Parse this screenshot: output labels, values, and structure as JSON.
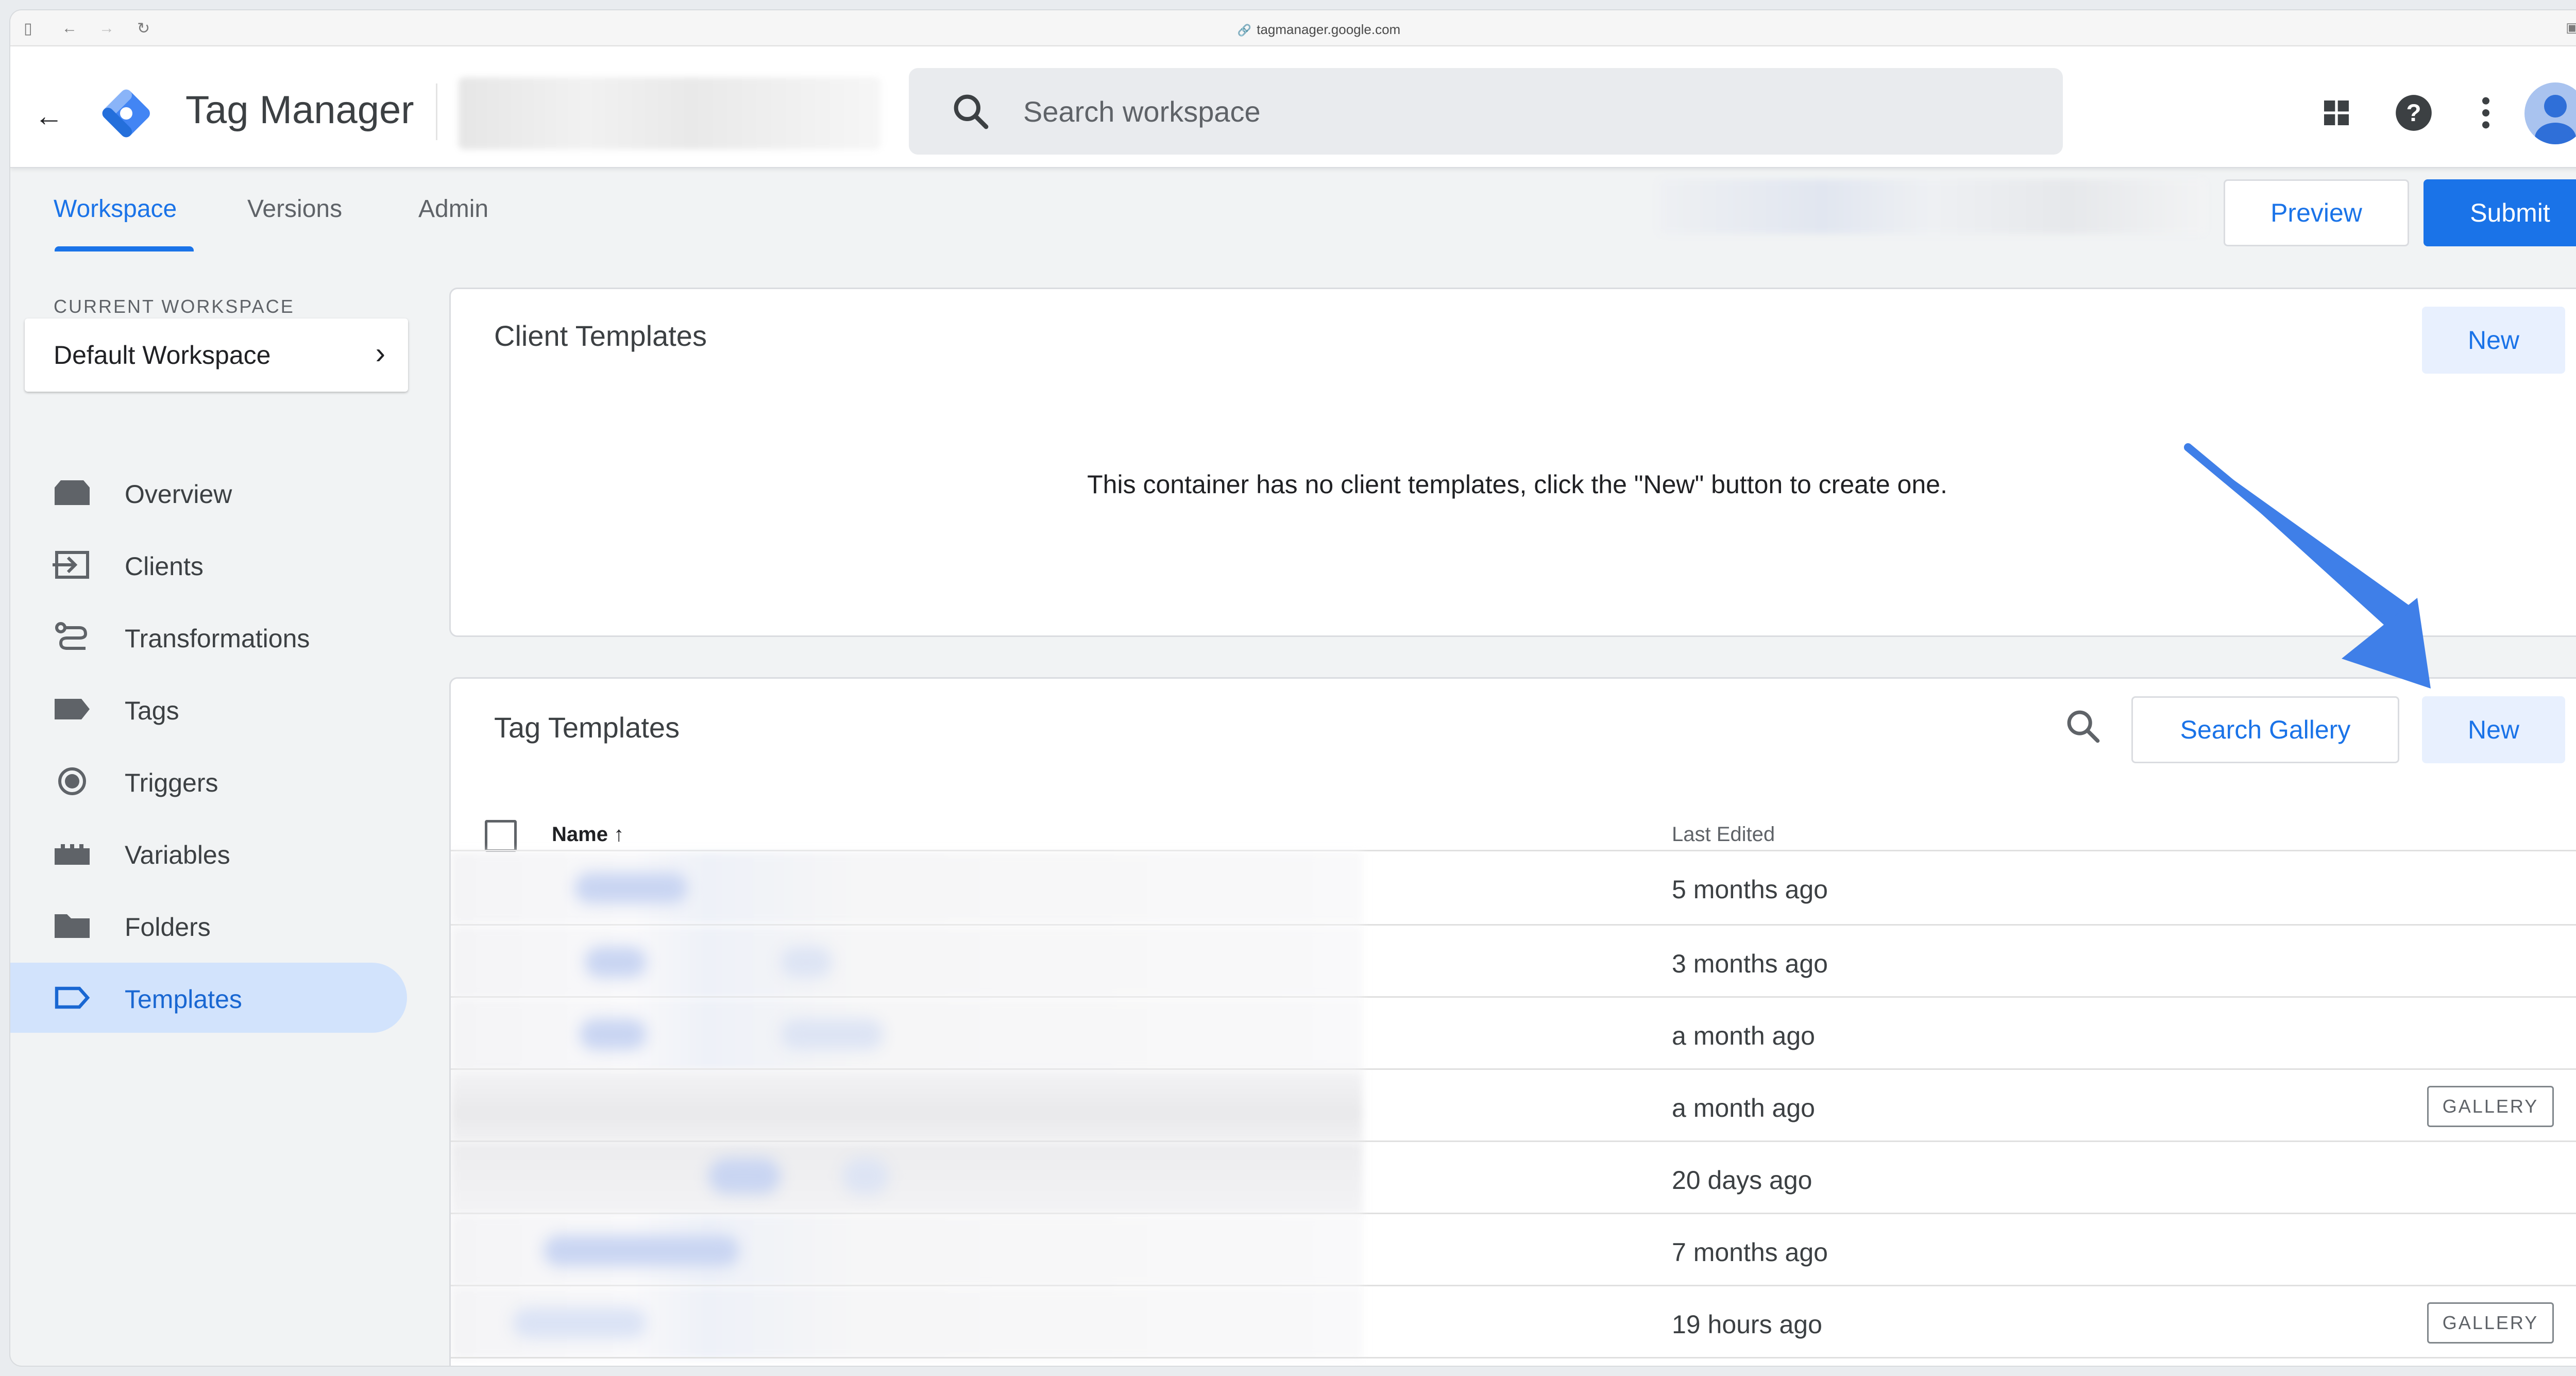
{
  "browser": {
    "url": "tagmanager.google.com"
  },
  "header": {
    "product_name": "Tag Manager",
    "search_placeholder": "Search workspace"
  },
  "tabs": [
    {
      "label": "Workspace",
      "active": true
    },
    {
      "label": "Versions",
      "active": false
    },
    {
      "label": "Admin",
      "active": false
    }
  ],
  "toolbar": {
    "preview_label": "Preview",
    "submit_label": "Submit"
  },
  "sidebar": {
    "current_workspace_label": "CURRENT WORKSPACE",
    "workspace_name": "Default Workspace",
    "items": [
      {
        "label": "Overview",
        "icon": "overview-icon",
        "active": false
      },
      {
        "label": "Clients",
        "icon": "clients-icon",
        "active": false
      },
      {
        "label": "Transformations",
        "icon": "transformations-icon",
        "active": false
      },
      {
        "label": "Tags",
        "icon": "tag-icon",
        "active": false
      },
      {
        "label": "Triggers",
        "icon": "trigger-icon",
        "active": false
      },
      {
        "label": "Variables",
        "icon": "variables-icon",
        "active": false
      },
      {
        "label": "Folders",
        "icon": "folder-icon",
        "active": false
      },
      {
        "label": "Templates",
        "icon": "template-icon",
        "active": true
      }
    ]
  },
  "client_templates": {
    "title": "Client Templates",
    "new_label": "New",
    "empty_message": "This container has no client templates, click the \"New\" button to create one."
  },
  "tag_templates": {
    "title": "Tag Templates",
    "search_gallery_label": "Search Gallery",
    "new_label": "New",
    "columns": {
      "name": "Name",
      "last_edited": "Last Edited"
    },
    "rows": [
      {
        "last_edited": "5 months ago",
        "badge": ""
      },
      {
        "last_edited": "3 months ago",
        "badge": ""
      },
      {
        "last_edited": "a month ago",
        "badge": ""
      },
      {
        "last_edited": "a month ago",
        "badge": "GALLERY"
      },
      {
        "last_edited": "20 days ago",
        "badge": ""
      },
      {
        "last_edited": "7 months ago",
        "badge": ""
      },
      {
        "last_edited": "19 hours ago",
        "badge": "GALLERY"
      }
    ]
  },
  "colors": {
    "accent": "#1a73e8",
    "active_nav_bg": "#d2e3fc",
    "annotation_arrow": "#3f7fe8"
  }
}
